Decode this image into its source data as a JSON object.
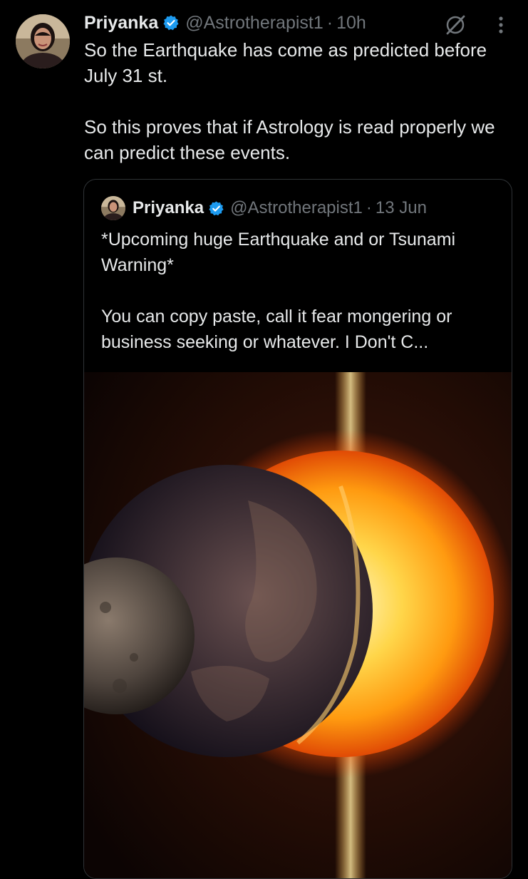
{
  "tweet": {
    "author_name": "Priyanka",
    "handle": "@Astrotherapist1",
    "separator": "·",
    "time": "10h",
    "paragraphs": [
      "So the Earthquake has come as predicted before July 31 st.",
      "So this proves that if Astrology is read properly we can predict these events."
    ]
  },
  "quoted_tweet": {
    "author_name": "Priyanka",
    "handle": "@Astrotherapist1",
    "separator": "·",
    "time": "13 Jun",
    "paragraphs": [
      "*Upcoming huge Earthquake and or Tsunami Warning*",
      "You can copy paste, call it fear mongering or business seeking or whatever. I Don't C..."
    ]
  },
  "icons": {
    "verified": "verified-badge-icon",
    "grok": "grok-icon",
    "more": "more-options-icon"
  },
  "colors": {
    "background": "#000000",
    "text_primary": "#e7e9ea",
    "text_secondary": "#71767b",
    "verified_blue": "#1d9bf0",
    "border": "#2f3336"
  }
}
